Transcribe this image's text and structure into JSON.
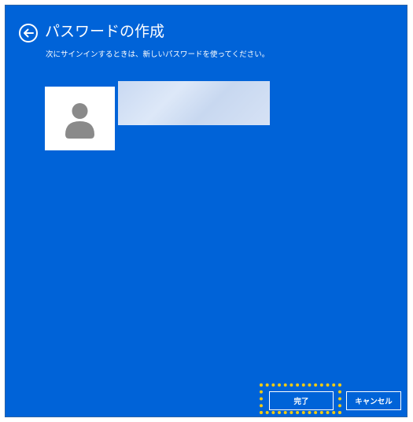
{
  "header": {
    "title": "パスワードの作成",
    "subtitle": "次にサインインするときは、新しいパスワードを使ってください。"
  },
  "icons": {
    "back": "back-arrow-icon",
    "avatar": "user-icon"
  },
  "footer": {
    "done_label": "完了",
    "cancel_label": "キャンセル"
  },
  "colors": {
    "background": "#0063d8",
    "highlight": "#f2cb12",
    "text": "#ffffff"
  }
}
